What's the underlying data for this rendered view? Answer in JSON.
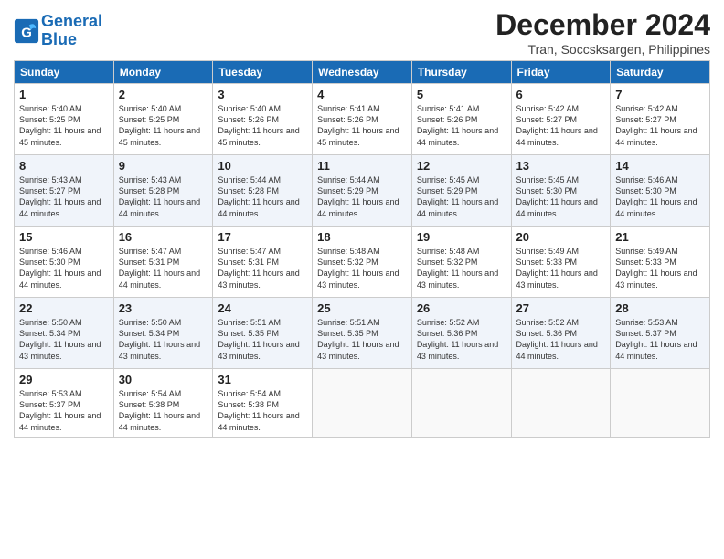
{
  "header": {
    "logo_line1": "General",
    "logo_line2": "Blue",
    "month_title": "December 2024",
    "location": "Tran, Soccsksargen, Philippines"
  },
  "columns": [
    "Sunday",
    "Monday",
    "Tuesday",
    "Wednesday",
    "Thursday",
    "Friday",
    "Saturday"
  ],
  "weeks": [
    [
      {
        "day": "1",
        "rise": "5:40 AM",
        "set": "5:25 PM",
        "daylight": "11 hours and 45 minutes."
      },
      {
        "day": "2",
        "rise": "5:40 AM",
        "set": "5:25 PM",
        "daylight": "11 hours and 45 minutes."
      },
      {
        "day": "3",
        "rise": "5:40 AM",
        "set": "5:26 PM",
        "daylight": "11 hours and 45 minutes."
      },
      {
        "day": "4",
        "rise": "5:41 AM",
        "set": "5:26 PM",
        "daylight": "11 hours and 45 minutes."
      },
      {
        "day": "5",
        "rise": "5:41 AM",
        "set": "5:26 PM",
        "daylight": "11 hours and 44 minutes."
      },
      {
        "day": "6",
        "rise": "5:42 AM",
        "set": "5:27 PM",
        "daylight": "11 hours and 44 minutes."
      },
      {
        "day": "7",
        "rise": "5:42 AM",
        "set": "5:27 PM",
        "daylight": "11 hours and 44 minutes."
      }
    ],
    [
      {
        "day": "8",
        "rise": "5:43 AM",
        "set": "5:27 PM",
        "daylight": "11 hours and 44 minutes."
      },
      {
        "day": "9",
        "rise": "5:43 AM",
        "set": "5:28 PM",
        "daylight": "11 hours and 44 minutes."
      },
      {
        "day": "10",
        "rise": "5:44 AM",
        "set": "5:28 PM",
        "daylight": "11 hours and 44 minutes."
      },
      {
        "day": "11",
        "rise": "5:44 AM",
        "set": "5:29 PM",
        "daylight": "11 hours and 44 minutes."
      },
      {
        "day": "12",
        "rise": "5:45 AM",
        "set": "5:29 PM",
        "daylight": "11 hours and 44 minutes."
      },
      {
        "day": "13",
        "rise": "5:45 AM",
        "set": "5:30 PM",
        "daylight": "11 hours and 44 minutes."
      },
      {
        "day": "14",
        "rise": "5:46 AM",
        "set": "5:30 PM",
        "daylight": "11 hours and 44 minutes."
      }
    ],
    [
      {
        "day": "15",
        "rise": "5:46 AM",
        "set": "5:30 PM",
        "daylight": "11 hours and 44 minutes."
      },
      {
        "day": "16",
        "rise": "5:47 AM",
        "set": "5:31 PM",
        "daylight": "11 hours and 44 minutes."
      },
      {
        "day": "17",
        "rise": "5:47 AM",
        "set": "5:31 PM",
        "daylight": "11 hours and 43 minutes."
      },
      {
        "day": "18",
        "rise": "5:48 AM",
        "set": "5:32 PM",
        "daylight": "11 hours and 43 minutes."
      },
      {
        "day": "19",
        "rise": "5:48 AM",
        "set": "5:32 PM",
        "daylight": "11 hours and 43 minutes."
      },
      {
        "day": "20",
        "rise": "5:49 AM",
        "set": "5:33 PM",
        "daylight": "11 hours and 43 minutes."
      },
      {
        "day": "21",
        "rise": "5:49 AM",
        "set": "5:33 PM",
        "daylight": "11 hours and 43 minutes."
      }
    ],
    [
      {
        "day": "22",
        "rise": "5:50 AM",
        "set": "5:34 PM",
        "daylight": "11 hours and 43 minutes."
      },
      {
        "day": "23",
        "rise": "5:50 AM",
        "set": "5:34 PM",
        "daylight": "11 hours and 43 minutes."
      },
      {
        "day": "24",
        "rise": "5:51 AM",
        "set": "5:35 PM",
        "daylight": "11 hours and 43 minutes."
      },
      {
        "day": "25",
        "rise": "5:51 AM",
        "set": "5:35 PM",
        "daylight": "11 hours and 43 minutes."
      },
      {
        "day": "26",
        "rise": "5:52 AM",
        "set": "5:36 PM",
        "daylight": "11 hours and 43 minutes."
      },
      {
        "day": "27",
        "rise": "5:52 AM",
        "set": "5:36 PM",
        "daylight": "11 hours and 44 minutes."
      },
      {
        "day": "28",
        "rise": "5:53 AM",
        "set": "5:37 PM",
        "daylight": "11 hours and 44 minutes."
      }
    ],
    [
      {
        "day": "29",
        "rise": "5:53 AM",
        "set": "5:37 PM",
        "daylight": "11 hours and 44 minutes."
      },
      {
        "day": "30",
        "rise": "5:54 AM",
        "set": "5:38 PM",
        "daylight": "11 hours and 44 minutes."
      },
      {
        "day": "31",
        "rise": "5:54 AM",
        "set": "5:38 PM",
        "daylight": "11 hours and 44 minutes."
      },
      null,
      null,
      null,
      null
    ]
  ]
}
